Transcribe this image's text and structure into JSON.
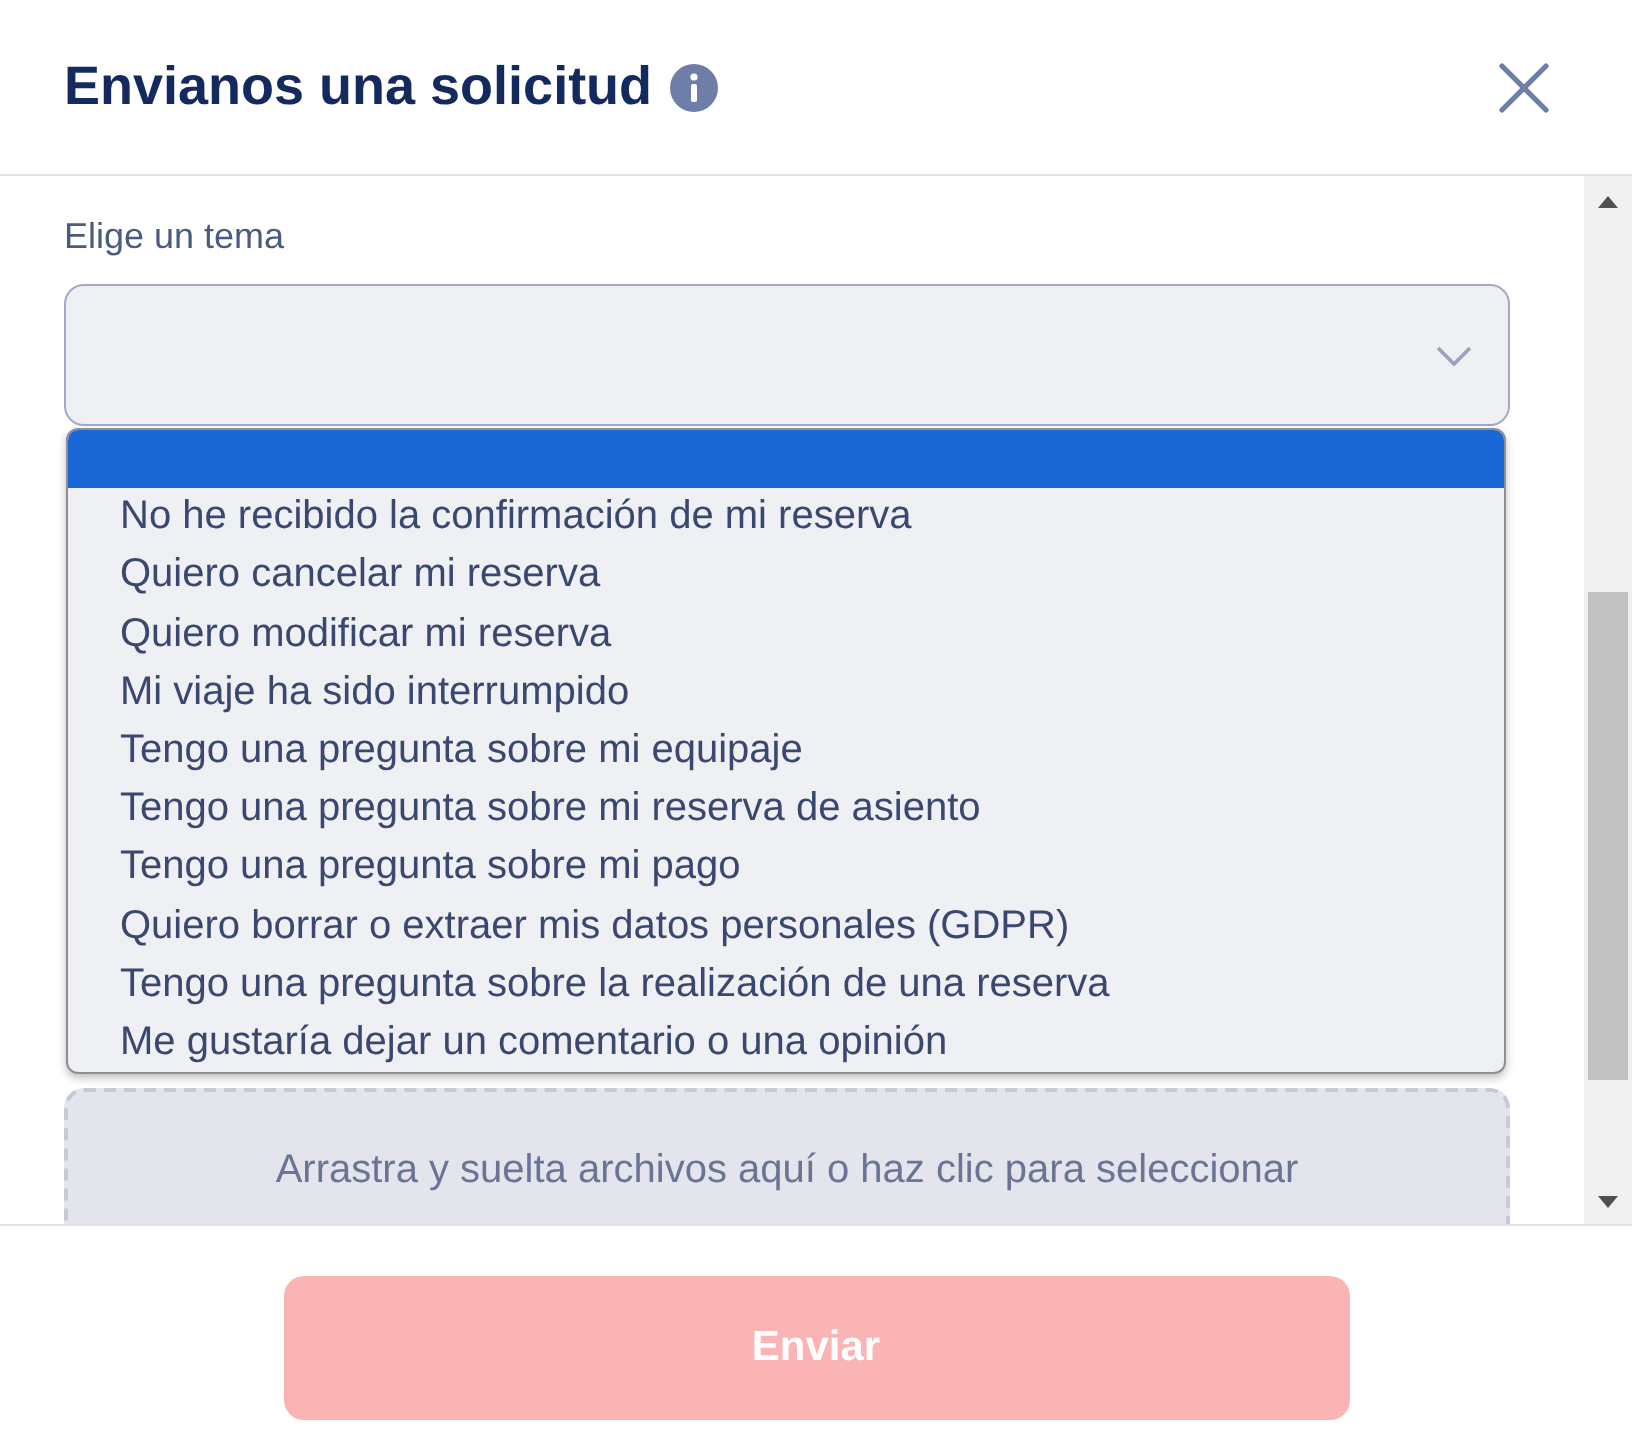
{
  "dialog": {
    "title": "Envianos una solicitud"
  },
  "topic": {
    "label": "Elige un tema",
    "expanded": true,
    "options": [
      {
        "selected": true
      },
      {
        "label": "No he recibido la confirmación de mi reserva",
        "selected": false
      },
      {
        "label": "Quiero cancelar mi reserva",
        "selected": false
      },
      {
        "label": "Quiero modificar mi reserva",
        "selected": false
      },
      {
        "label": "Mi viaje ha sido interrumpido",
        "selected": false
      },
      {
        "label": "Tengo una pregunta sobre mi equipaje",
        "selected": false
      },
      {
        "label": "Tengo una pregunta sobre mi reserva de asiento",
        "selected": false
      },
      {
        "label": "Tengo una pregunta sobre mi pago",
        "selected": false
      },
      {
        "label": "Quiero borrar o extraer mis datos personales (GDPR)",
        "selected": false
      },
      {
        "label": "Tengo una pregunta sobre la realización de una reserva",
        "selected": false
      },
      {
        "label": "Me gustaría dejar un comentario o una opinión",
        "selected": false
      }
    ]
  },
  "upload": {
    "text": "Arrastra y suelta archivos aquí o haz clic para seleccionar"
  },
  "submit": {
    "label": "Enviar",
    "disabled": true
  }
}
